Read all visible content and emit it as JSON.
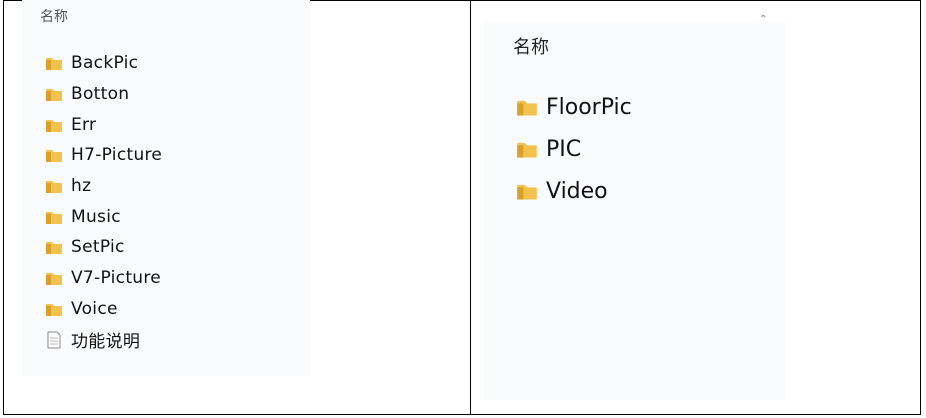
{
  "left_panel": {
    "column_header": "名称",
    "items": [
      {
        "name": "BackPic",
        "icon": "folder-icon"
      },
      {
        "name": "Botton",
        "icon": "folder-icon"
      },
      {
        "name": "Err",
        "icon": "folder-icon"
      },
      {
        "name": "H7-Picture",
        "icon": "folder-icon"
      },
      {
        "name": "hz",
        "icon": "folder-icon"
      },
      {
        "name": "Music",
        "icon": "folder-icon"
      },
      {
        "name": "SetPic",
        "icon": "folder-icon"
      },
      {
        "name": "V7-Picture",
        "icon": "folder-icon"
      },
      {
        "name": "Voice",
        "icon": "folder-icon"
      },
      {
        "name": "功能说明",
        "icon": "text-file-icon"
      }
    ]
  },
  "right_panel": {
    "column_header": "名称",
    "items": [
      {
        "name": "FloorPic",
        "icon": "folder-icon"
      },
      {
        "name": "PIC",
        "icon": "folder-icon"
      },
      {
        "name": "Video",
        "icon": "folder-icon"
      }
    ]
  },
  "colors": {
    "folder": "#f2c14e",
    "folder_dark": "#d9a02a",
    "panel_bg": "#fafbfd"
  }
}
